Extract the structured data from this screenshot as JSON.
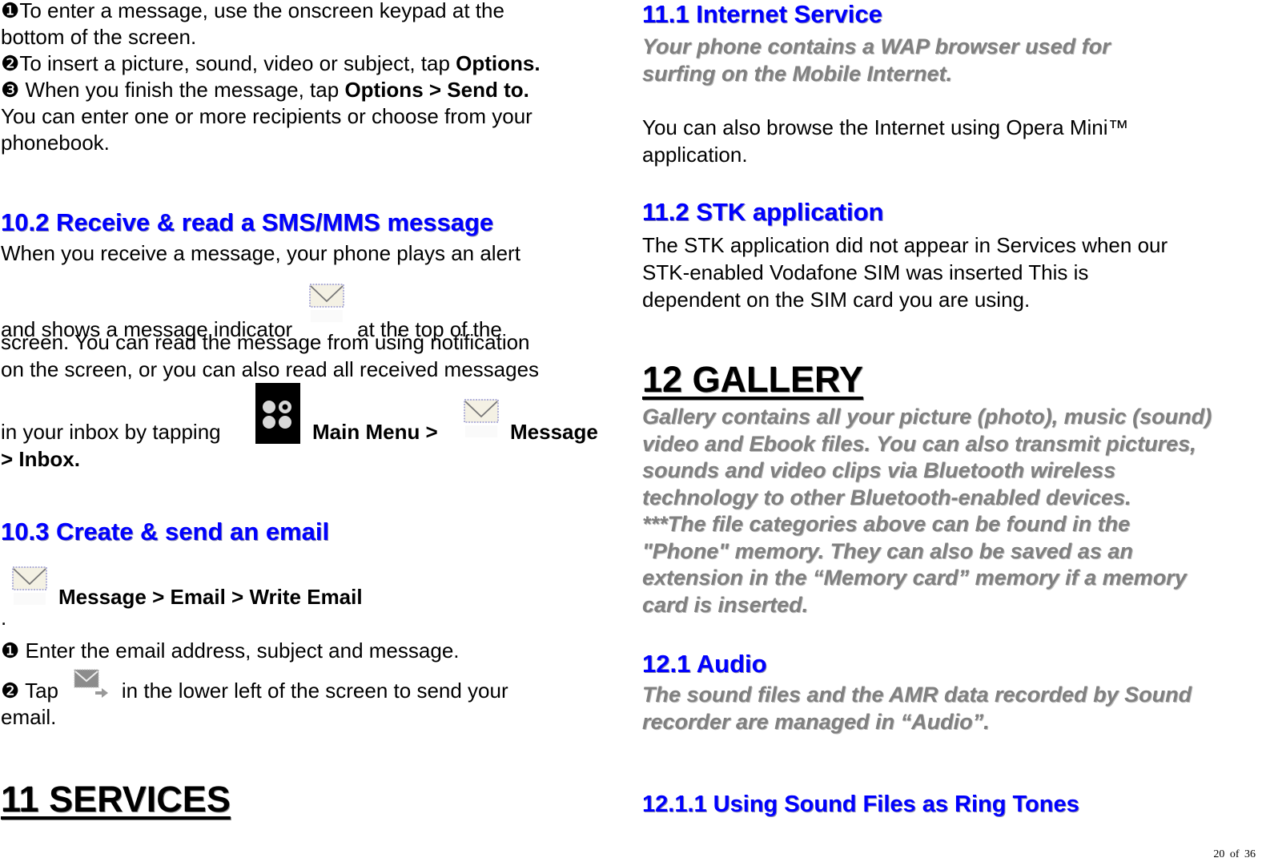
{
  "left": {
    "intro_lines": [
      {
        "bullet": "❶",
        "text": "To enter a message, use the onscreen keypad at the"
      },
      {
        "text": "bottom of the screen."
      },
      {
        "bullet": "❷",
        "text": "To insert a picture, sound, video or subject, tap ",
        "bold": "Options."
      },
      {
        "bullet": "❸",
        "text": " When you finish the message, tap ",
        "bold": "Options > Send to."
      },
      {
        "text": "You can enter one or more recipients or choose from your"
      },
      {
        "text": "phonebook."
      }
    ],
    "section_10_2": {
      "heading": "10.2 Receive & read a SMS/MMS message",
      "line1": "When you receive a message, your phone plays an alert",
      "line2_pre": "and shows a message indicator",
      "line2_post": "at the top of the",
      "line3": "screen. You can read the message from using notification",
      "line4": "on the screen, or you can also read all received messages",
      "line5_pre": "in your inbox by tapping",
      "main_menu": "Main Menu >",
      "message": "Message",
      "inbox": "> Inbox."
    },
    "section_10_3": {
      "heading": "10.3 Create & send an email",
      "path": "Message > Email > Write Email",
      "dot": ".",
      "step1_bullet": "❶",
      "step1": " Enter the email address, subject and message.",
      "step2_bullet": "❷",
      "step2_pre": " Tap",
      "step2_post": "in the lower left of the screen to send your",
      "step2_end": "email."
    },
    "chapter_11": "11 SERVICES"
  },
  "right": {
    "section_11_1": {
      "heading": "11.1 Internet Service",
      "italic_lines": [
        "Your phone contains a WAP browser used for",
        "surfing on the Mobile Internet."
      ],
      "body_lines": [
        "You can also browse the Internet using Opera Mini™",
        "application."
      ]
    },
    "section_11_2": {
      "heading": "11.2 STK application",
      "body_lines": [
        "The STK application did not appear in Services when our",
        "STK-enabled Vodafone SIM was inserted This is",
        "dependent on the SIM card you are using."
      ]
    },
    "chapter_12": {
      "heading": "12 GALLERY",
      "italic_lines": [
        "Gallery contains all your picture (photo), music (sound)",
        "video and Ebook files. You can also transmit pictures,",
        "sounds and video clips via Bluetooth wireless",
        "technology to other Bluetooth-enabled devices.",
        "***The file categories above can be found in the",
        "\"Phone\" memory. They can also be saved as an",
        "extension in the “Memory card” memory if a memory",
        "card is inserted."
      ]
    },
    "section_12_1": {
      "heading": "12.1 Audio",
      "italic_lines": [
        "The sound files and the AMR data recorded by Sound",
        "recorder are managed in “Audio”."
      ]
    },
    "section_12_1_1": {
      "heading": "12.1.1 Using Sound Files as Ring Tones"
    }
  },
  "footer": {
    "page": "20",
    "of": "of",
    "total": "36"
  },
  "colors": {
    "heading_blue": "#0000ff",
    "italic_gray": "#808080",
    "text": "#000000"
  }
}
